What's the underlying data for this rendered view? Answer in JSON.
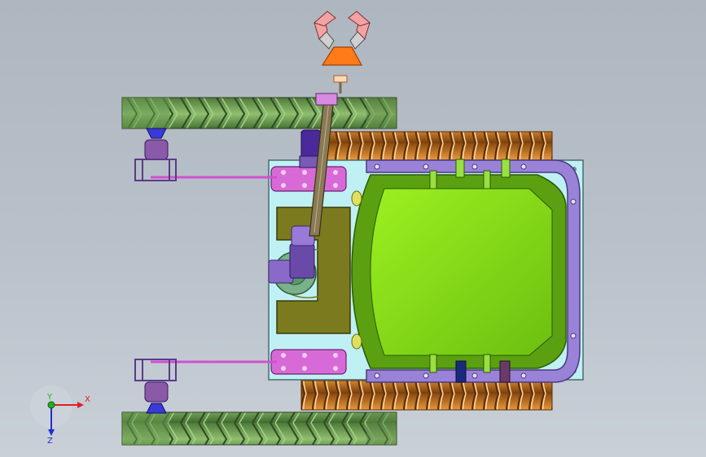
{
  "viewport": {
    "background_top": "#aeb6c0",
    "background_bottom": "#c9d0d8"
  },
  "triad": {
    "x_label": "X",
    "y_label": "Y",
    "z_label": "Z",
    "x_color": "#e02020",
    "y_color": "#20b020",
    "z_color": "#2030d0"
  },
  "colors": {
    "wheel_green": "#6f9a55",
    "tread_orange": "#d88a2e",
    "hull_green": "#7ad313",
    "frame_purple": "#9a82d8",
    "plate_cyan": "#bff0f4",
    "bracket_olive": "#7b7a1e",
    "gripper_orange": "#ff7a18",
    "gripper_pink": "#f3a3a3",
    "arm_brown": "#8a7a55",
    "motor_purple": "#7a5ab8"
  },
  "icons": [
    "robot-assembly",
    "coordinate-triad-icon"
  ]
}
